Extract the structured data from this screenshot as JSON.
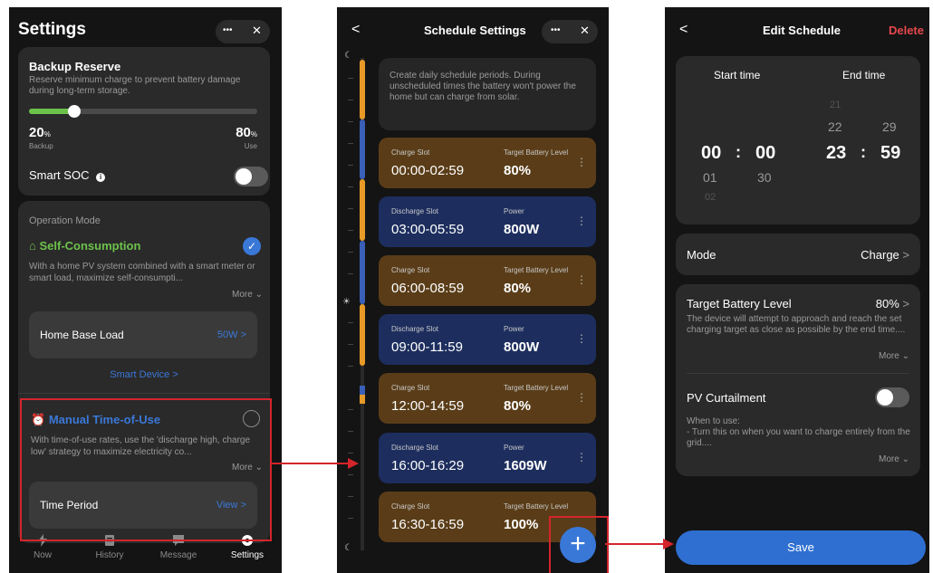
{
  "settings": {
    "title": "Settings",
    "more_label": "•••",
    "close_label": "✕",
    "backup": {
      "title": "Backup Reserve",
      "desc": "Reserve minimum charge to prevent battery damage during long-term storage.",
      "backup_value": "20",
      "backup_unit": "%",
      "backup_label": "Backup",
      "use_value": "80",
      "use_unit": "%",
      "use_label": "Use",
      "slider_level": 0.2
    },
    "smart_soc": {
      "label": "Smart SOC",
      "info": "i",
      "enabled": false
    },
    "operation_mode": {
      "title": "Operation Mode",
      "self_consumption": {
        "label": "Self-Consumption",
        "desc": "With a home PV system combined with a smart meter or smart load, maximize self-consumpti...",
        "more": "More",
        "selected": true
      },
      "home_base_load": {
        "label": "Home Base Load",
        "value": "50W"
      },
      "smart_device": "Smart Device",
      "manual_tou": {
        "label": "Manual Time-of-Use",
        "desc": "With time-of-use rates, use the 'discharge high, charge low' strategy to maximize electricity co...",
        "more": "More",
        "selected": false
      },
      "time_period": {
        "label": "Time Period",
        "action": "View"
      }
    },
    "nav": [
      {
        "label": "Now",
        "icon": "bolt-icon",
        "active": false
      },
      {
        "label": "History",
        "icon": "history-icon",
        "active": false
      },
      {
        "label": "Message",
        "icon": "message-icon",
        "active": false
      },
      {
        "label": "Settings",
        "icon": "gear-icon",
        "active": true
      }
    ]
  },
  "schedule": {
    "title": "Schedule Settings",
    "back_label": "<",
    "more_label": "•••",
    "close_label": "✕",
    "info": "Create daily schedule periods. During unscheduled times the battery won't power the home but can charge from solar.",
    "slots": [
      {
        "type": "Charge Slot",
        "time": "00:00-02:59",
        "metric_label": "Target Battery Level",
        "value": "80%",
        "kind": "charge"
      },
      {
        "type": "Discharge Slot",
        "time": "03:00-05:59",
        "metric_label": "Power",
        "value": "800W",
        "kind": "discharge"
      },
      {
        "type": "Charge Slot",
        "time": "06:00-08:59",
        "metric_label": "Target Battery Level",
        "value": "80%",
        "kind": "charge"
      },
      {
        "type": "Discharge Slot",
        "time": "09:00-11:59",
        "metric_label": "Power",
        "value": "800W",
        "kind": "discharge"
      },
      {
        "type": "Charge Slot",
        "time": "12:00-14:59",
        "metric_label": "Target Battery Level",
        "value": "80%",
        "kind": "charge"
      },
      {
        "type": "Discharge Slot",
        "time": "16:00-16:29",
        "metric_label": "Power",
        "value": "1609W",
        "kind": "discharge"
      },
      {
        "type": "Charge Slot",
        "time": "16:30-16:59",
        "metric_label": "Target Battery Level",
        "value": "100%",
        "kind": "charge"
      }
    ],
    "add_label": "+"
  },
  "edit": {
    "back_label": "<",
    "title": "Edit Schedule",
    "delete_label": "Delete",
    "start_label": "Start time",
    "end_label": "End time",
    "start_hour": "00",
    "start_min": "00",
    "end_hour": "23",
    "end_min": "59",
    "colon": ":",
    "start_hour_next": "01",
    "start_hour_next2": "02",
    "start_min_next": "30",
    "end_hour_prev": "22",
    "end_hour_prev2": "21",
    "end_min_prev": "29",
    "mode": {
      "label": "Mode",
      "value": "Charge"
    },
    "target": {
      "label": "Target Battery Level",
      "value": "80%",
      "desc": "The device will attempt to approach and reach the set charging target as close as possible by the end time....",
      "more": "More"
    },
    "pv": {
      "label": "PV Curtailment",
      "enabled": false,
      "desc_head": "When to use:",
      "desc": "- Turn this on when you want to charge entirely from the grid....",
      "more": "More"
    },
    "save_label": "Save"
  },
  "colors": {
    "accent_blue": "#3a78d8",
    "highlight_red": "#d4252b",
    "charge_slot": "#5a3d18",
    "discharge_slot": "#1d2e5e",
    "green": "#6cc24a",
    "delete_red": "#e5484d"
  }
}
